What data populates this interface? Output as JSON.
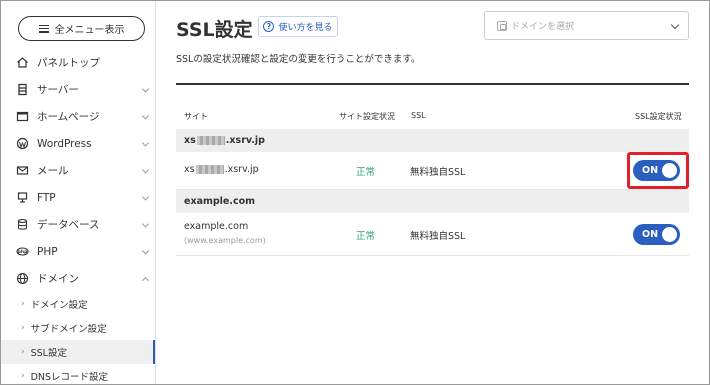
{
  "sidebar": {
    "menu_button_label": "全メニュー表示",
    "items": [
      {
        "label": "パネルトップ",
        "icon": "home-icon"
      },
      {
        "label": "サーバー",
        "icon": "server-icon"
      },
      {
        "label": "ホームページ",
        "icon": "window-icon"
      },
      {
        "label": "WordPress",
        "icon": "wordpress-icon"
      },
      {
        "label": "メール",
        "icon": "mail-icon"
      },
      {
        "label": "FTP",
        "icon": "monitor-icon"
      },
      {
        "label": "データベース",
        "icon": "database-icon"
      },
      {
        "label": "PHP",
        "icon": "php-icon"
      },
      {
        "label": "ドメイン",
        "icon": "globe-icon"
      }
    ],
    "sub_items": [
      {
        "label": "ドメイン設定"
      },
      {
        "label": "サブドメイン設定"
      },
      {
        "label": "SSL設定",
        "active": true
      },
      {
        "label": "DNSレコード設定"
      }
    ]
  },
  "page": {
    "title": "SSL設定",
    "help_label": "使い方を見る",
    "domain_select_placeholder": "ドメインを選択",
    "description": "SSLの設定状況確認と設定の変更を行うことができます。"
  },
  "table": {
    "headers": {
      "site": "サイト",
      "site_status": "サイト設定状況",
      "ssl": "SSL",
      "ssl_status": "SSL設定状況"
    },
    "groups": [
      {
        "name_prefix": "xs",
        "name_suffix": ".xsrv.jp",
        "rows": [
          {
            "site_prefix": "xs",
            "site_suffix": ".xsrv.jp",
            "status": "正常",
            "ssl": "無料独自SSL",
            "toggle": "ON"
          }
        ]
      },
      {
        "name": "example.com",
        "rows": [
          {
            "site": "example.com",
            "site_sub": "(www.example.com)",
            "status": "正常",
            "ssl": "無料独自SSL",
            "toggle": "ON"
          }
        ]
      }
    ]
  },
  "colors": {
    "accent": "#2a5fbf",
    "status_ok": "#2ea58a",
    "highlight": "#e0202a"
  }
}
